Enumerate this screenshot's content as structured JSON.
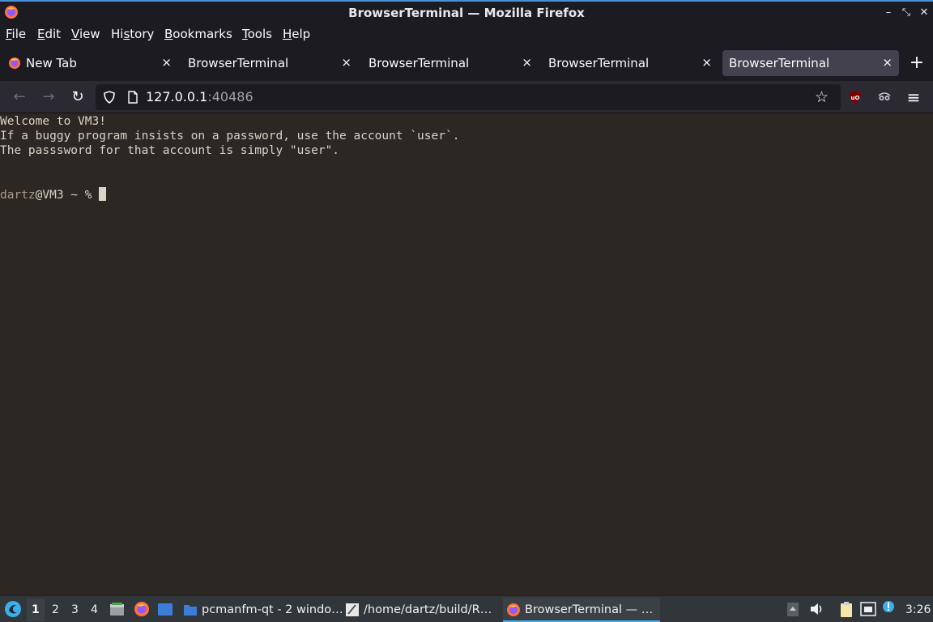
{
  "window": {
    "title": "BrowserTerminal — Mozilla Firefox",
    "controls": [
      "minimize",
      "maximize",
      "close"
    ]
  },
  "menubar": {
    "items": [
      {
        "label": "File",
        "mnemonic": "F",
        "rest": "ile"
      },
      {
        "label": "Edit",
        "mnemonic": "E",
        "rest": "dit"
      },
      {
        "label": "View",
        "mnemonic": "V",
        "rest": "iew"
      },
      {
        "label": "History",
        "mnemonic": "s",
        "before": "Hi",
        "rest": "tory"
      },
      {
        "label": "Bookmarks",
        "mnemonic": "B",
        "rest": "ookmarks"
      },
      {
        "label": "Tools",
        "mnemonic": "T",
        "rest": "ools"
      },
      {
        "label": "Help",
        "mnemonic": "H",
        "rest": "elp"
      }
    ]
  },
  "tabs": [
    {
      "label": "New Tab",
      "has_icon": true,
      "active": false
    },
    {
      "label": "BrowserTerminal",
      "has_icon": false,
      "active": false
    },
    {
      "label": "BrowserTerminal",
      "has_icon": false,
      "active": false
    },
    {
      "label": "BrowserTerminal",
      "has_icon": false,
      "active": false
    },
    {
      "label": "BrowserTerminal",
      "has_icon": false,
      "active": true
    }
  ],
  "tab_close_glyph": "×",
  "new_tab_glyph": "+",
  "navbar": {
    "back_glyph": "←",
    "forward_glyph": "→",
    "reload_glyph": "↻",
    "url_host": "127.0.0.1",
    "url_port": ":40486",
    "menu_glyph": "≡"
  },
  "terminal": {
    "lines": [
      "Welcome to VM3!",
      "If a buggy program insists on a password, use the account `user`.",
      "The passsword for that account is simply \"user\"."
    ],
    "prompt_user": "dartz",
    "prompt_rest": "@VM3 ~ % "
  },
  "taskbar": {
    "desktops": [
      "1",
      "2",
      "3",
      "4"
    ],
    "active_desktop": "1",
    "tasks": [
      {
        "label": "pcmanfm-qt - 2 windo…",
        "icon": "folder-icon"
      },
      {
        "label": "/home/dartz/build/R…",
        "icon": "text-editor-icon"
      },
      {
        "label": "BrowserTerminal — …",
        "icon": "firefox-icon",
        "active": true
      }
    ],
    "clock": "3:26"
  },
  "colors": {
    "accent": "#3daee9",
    "terminal_bg": "#2c2722",
    "terminal_fg": "#d9d2c6",
    "ublock_red": "#800000"
  }
}
